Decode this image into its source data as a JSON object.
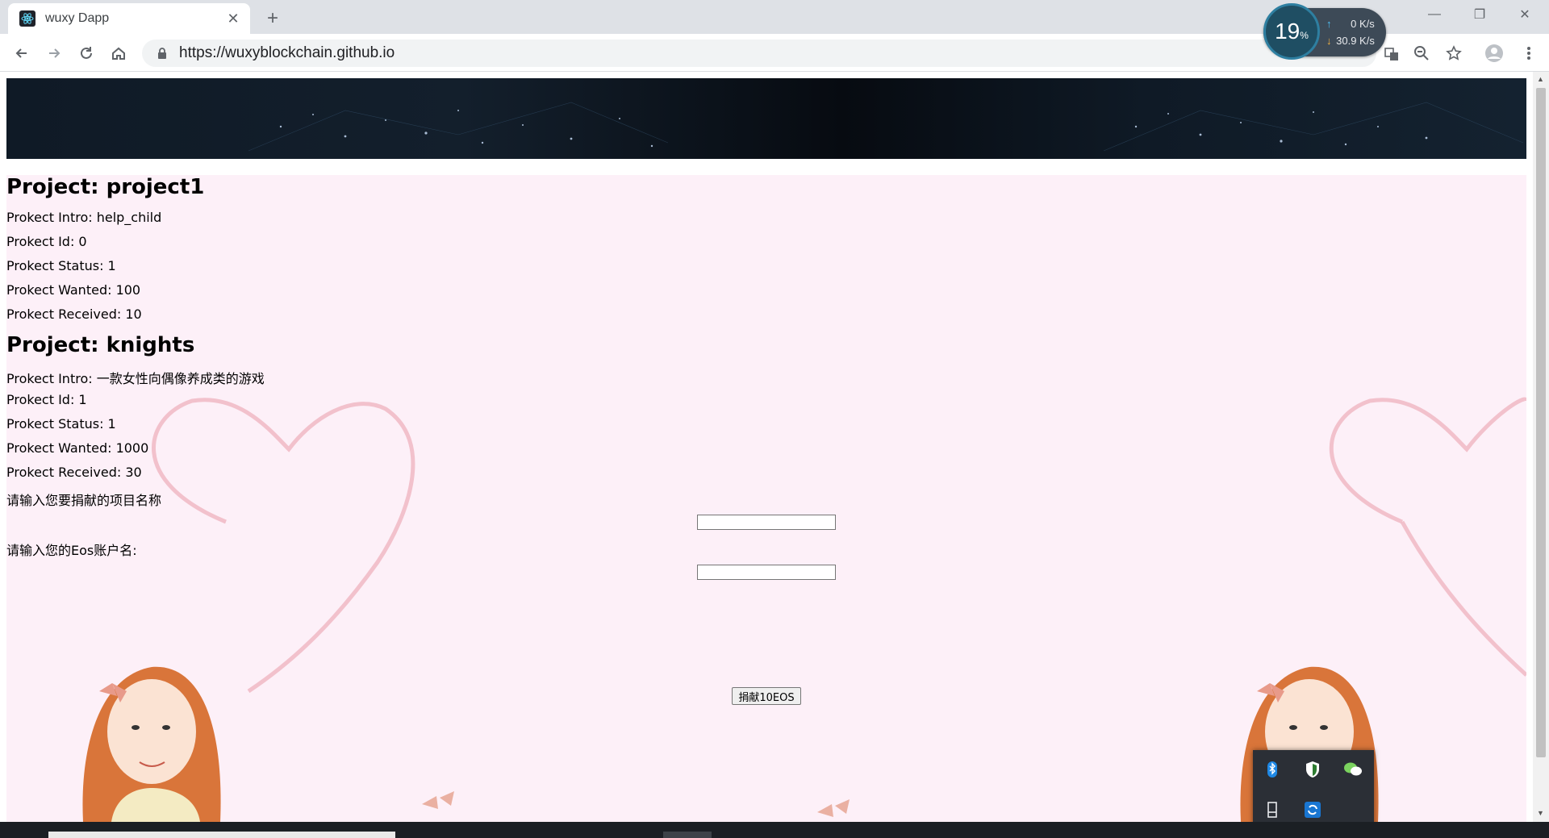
{
  "browser": {
    "tab_title": "wuxy Dapp",
    "url": "https://wuxyblockchain.github.io",
    "tab_close_glyph": "✕",
    "new_tab_glyph": "+",
    "window_controls": [
      "—",
      "❐",
      "✕"
    ],
    "icons": [
      "react-favicon-icon",
      "back-arrow-icon",
      "forward-arrow-icon",
      "reload-icon",
      "home-icon",
      "lock-icon",
      "translate-icon",
      "zoom-icon",
      "star-icon",
      "profile-icon",
      "menu-dots-icon"
    ]
  },
  "net_widget": {
    "percent": "19",
    "percent_unit": "%",
    "upload": "0 K/s",
    "download": "30.9 K/s"
  },
  "projects": [
    {
      "title": "Project: project1",
      "intro": "Prokect Intro: help_child",
      "id": "Prokect Id: 0",
      "status": "Prokect Status: 1",
      "wanted": "Prokect Wanted: 100",
      "received": "Prokect Received: 10"
    },
    {
      "title": "Project: knights",
      "intro": "Prokect Intro: 一款女性向偶像养成类的游戏",
      "id": "Prokect Id: 1",
      "status": "Prokect Status: 1",
      "wanted": "Prokect Wanted: 1000",
      "received": "Prokect Received: 30"
    }
  ],
  "form": {
    "project_label": "请输入您要捐献的项目名称",
    "project_value": "",
    "account_label": "请输入您的Eos账户名:",
    "account_value": "",
    "donate_button": "捐献10EOS"
  },
  "tray": {
    "icons": [
      "bluetooth-icon",
      "security-shield-icon",
      "wechat-icon",
      "usb-device-icon",
      "sync-app-icon"
    ]
  },
  "colors": {
    "content_bg": "#fdf0f8",
    "banner_bg": "#0f1a26",
    "heart_stroke": "#f0b8c4",
    "hair": "#d9753a"
  }
}
